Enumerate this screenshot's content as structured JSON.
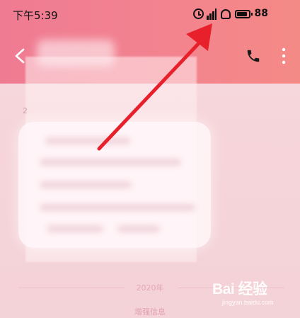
{
  "status_bar": {
    "time": "下午5:39",
    "battery": "88",
    "battery_fraction": 0.88,
    "icons": [
      "alarm-icon",
      "signal-icon",
      "hd-voice-icon",
      "battery-icon"
    ]
  },
  "header": {
    "back_icon": "chevron-left-icon",
    "call_icon": "phone-icon",
    "more_icon": "more-vertical-icon"
  },
  "conversation": {
    "date_stub": "2",
    "divider_label": "2020年",
    "footer_link": "增强信息"
  },
  "watermark": {
    "main": "Bai 经验",
    "sub": "jingyan.baidu.com"
  },
  "colors": {
    "header_start": "#ef7b93",
    "header_end": "#f48a86",
    "arrow": "#e8202b",
    "background": "#f6d5da"
  }
}
